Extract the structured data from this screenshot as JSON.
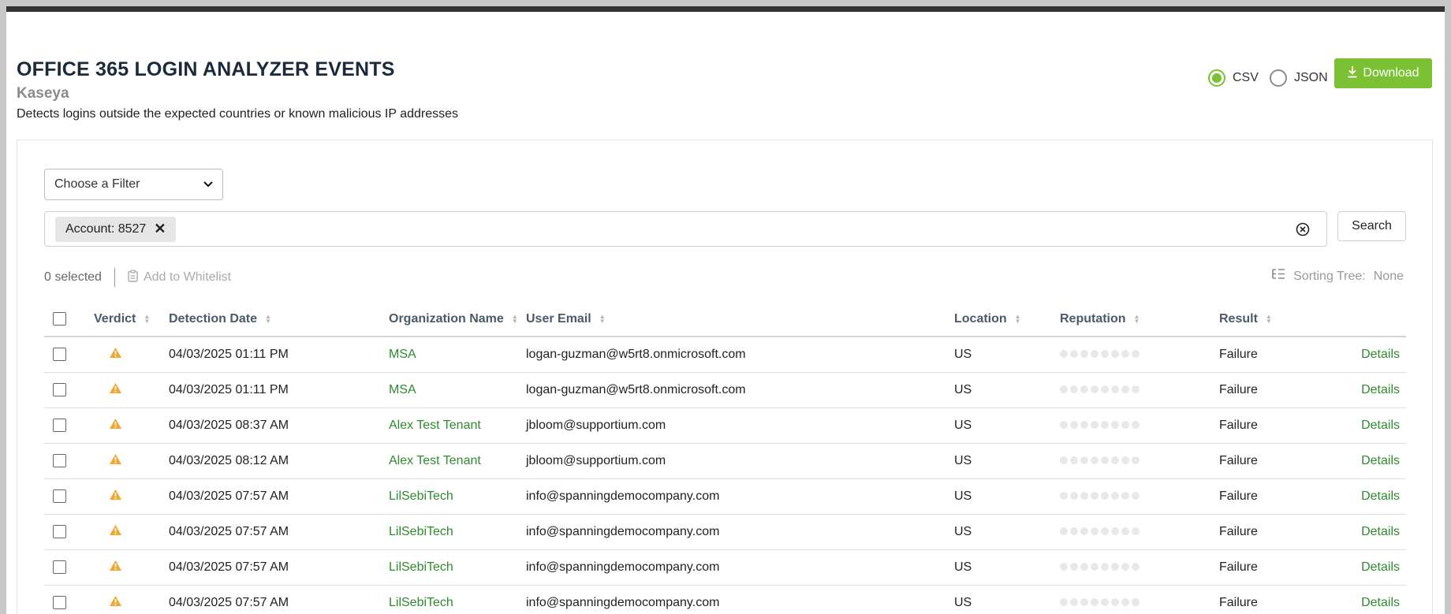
{
  "header": {
    "title": "OFFICE 365 LOGIN ANALYZER EVENTS",
    "vendor": "Kaseya",
    "description": "Detects logins outside the expected countries or known malicious IP addresses"
  },
  "export": {
    "options": [
      "CSV",
      "JSON"
    ],
    "selected": "CSV",
    "download_label": "Download"
  },
  "filters": {
    "select_placeholder": "Choose a Filter",
    "chip_label": "Account:",
    "chip_value": "8527",
    "search_label": "Search"
  },
  "selection": {
    "count_text": "0 selected",
    "add_whitelist_label": "Add to Whitelist",
    "sorting_label": "Sorting Tree:",
    "sorting_value": "None"
  },
  "table": {
    "columns": [
      "Verdict",
      "Detection Date",
      "Organization Name",
      "User Email",
      "Location",
      "Reputation",
      "Result"
    ],
    "rows": [
      {
        "date": "04/03/2025 01:11 PM",
        "org": "MSA",
        "email": "logan-guzman@w5rt8.onmicrosoft.com",
        "location": "US",
        "result": "Failure",
        "action": "Details"
      },
      {
        "date": "04/03/2025 01:11 PM",
        "org": "MSA",
        "email": "logan-guzman@w5rt8.onmicrosoft.com",
        "location": "US",
        "result": "Failure",
        "action": "Details"
      },
      {
        "date": "04/03/2025 08:37 AM",
        "org": "Alex Test Tenant",
        "email": "jbloom@supportium.com",
        "location": "US",
        "result": "Failure",
        "action": "Details"
      },
      {
        "date": "04/03/2025 08:12 AM",
        "org": "Alex Test Tenant",
        "email": "jbloom@supportium.com",
        "location": "US",
        "result": "Failure",
        "action": "Details"
      },
      {
        "date": "04/03/2025 07:57 AM",
        "org": "LilSebiTech",
        "email": "info@spanningdemocompany.com",
        "location": "US",
        "result": "Failure",
        "action": "Details"
      },
      {
        "date": "04/03/2025 07:57 AM",
        "org": "LilSebiTech",
        "email": "info@spanningdemocompany.com",
        "location": "US",
        "result": "Failure",
        "action": "Details"
      },
      {
        "date": "04/03/2025 07:57 AM",
        "org": "LilSebiTech",
        "email": "info@spanningdemocompany.com",
        "location": "US",
        "result": "Failure",
        "action": "Details"
      },
      {
        "date": "04/03/2025 07:57 AM",
        "org": "LilSebiTech",
        "email": "info@spanningdemocompany.com",
        "location": "US",
        "result": "Failure",
        "action": "Details"
      }
    ]
  },
  "colors": {
    "accent_green": "#7cc134",
    "link_green": "#2e8b2e",
    "warning": "#f0a830"
  },
  "icons": {
    "verdict": "warning-triangle-icon",
    "download": "download-icon",
    "clear": "clear-circle-icon",
    "whitelist": "clipboard-icon",
    "sorting": "tree-list-icon"
  }
}
